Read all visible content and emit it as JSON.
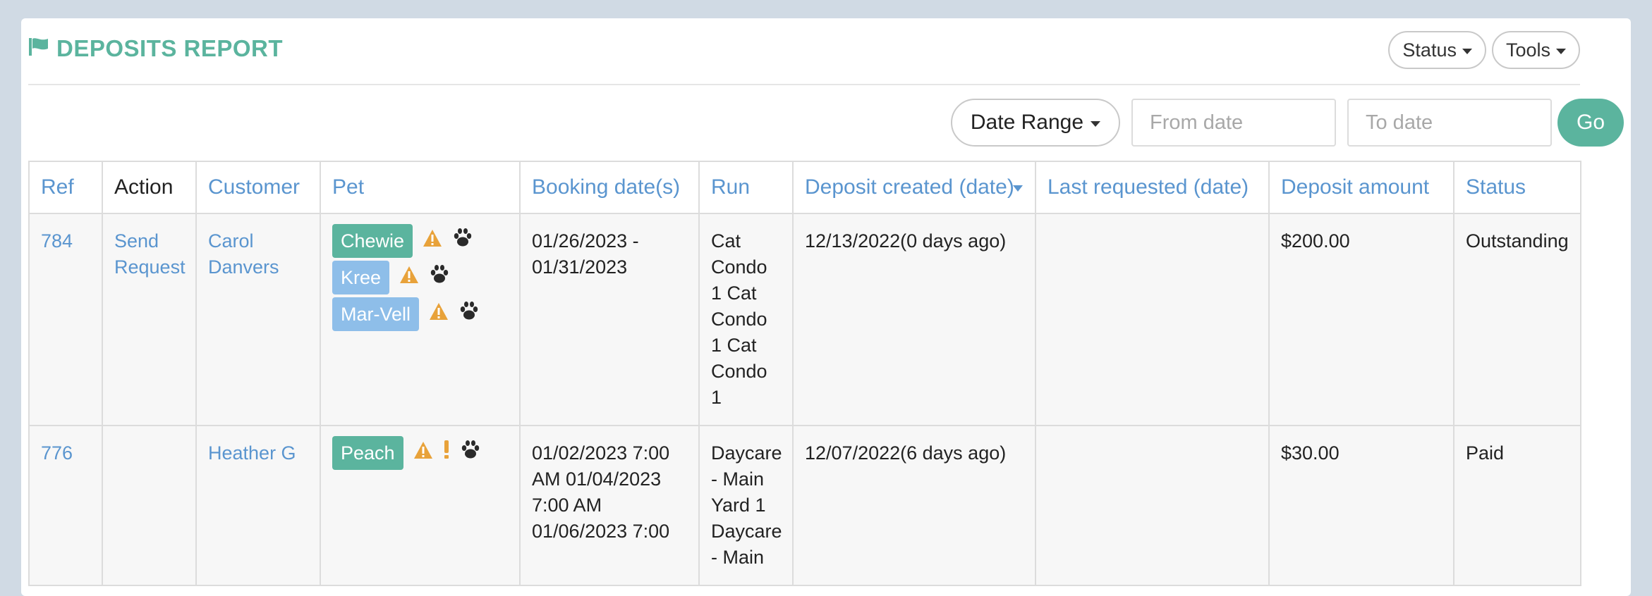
{
  "header": {
    "title": "DEPOSITS REPORT",
    "status_button": "Status",
    "tools_button": "Tools"
  },
  "filters": {
    "date_range_label": "Date Range",
    "from_placeholder": "From date",
    "to_placeholder": "To date",
    "go_label": "Go"
  },
  "columns": {
    "ref": "Ref",
    "action": "Action",
    "customer": "Customer",
    "pet": "Pet",
    "booking": "Booking date(s)",
    "run": "Run",
    "deposit_created": "Deposit created (date)",
    "last_requested": "Last requested (date)",
    "amount": "Deposit amount",
    "status": "Status"
  },
  "rows": [
    {
      "ref": "784",
      "action": "Send Request",
      "customer": "Carol Danvers",
      "pets": [
        {
          "name": "Chewie",
          "tag_color": "#5bb49e",
          "icons": [
            "warning-icon",
            "paw-icon"
          ]
        },
        {
          "name": "Kree",
          "tag_color": "#8ebee9",
          "icons": [
            "warning-icon",
            "paw-icon"
          ]
        },
        {
          "name": "Mar-Vell",
          "tag_color": "#8ebee9",
          "icons": [
            "warning-icon",
            "paw-icon"
          ]
        }
      ],
      "booking": "01/26/2023 - 01/31/2023",
      "run": "Cat Condo 1 Cat Condo 1 Cat Condo 1",
      "deposit_created": "12/13/2022(0 days ago)",
      "last_requested": "",
      "amount": "$200.00",
      "status": "Outstanding"
    },
    {
      "ref": "776",
      "action": "",
      "customer": "Heather G",
      "pets": [
        {
          "name": "Peach",
          "tag_color": "#5bb49e",
          "icons": [
            "warning-icon",
            "exclamation-icon",
            "paw-icon"
          ]
        }
      ],
      "booking": "01/02/2023 7:00 AM 01/04/2023 7:00 AM 01/06/2023 7:00",
      "run": "Daycare - Main Yard 1 Daycare - Main",
      "deposit_created": "12/07/2022(6 days ago)",
      "last_requested": "",
      "amount": "$30.00",
      "status": "Paid"
    }
  ],
  "colors": {
    "accent": "#5bb49e",
    "link": "#5a95cf",
    "warning": "#e8a23a",
    "tag_blue": "#8ebee9"
  }
}
